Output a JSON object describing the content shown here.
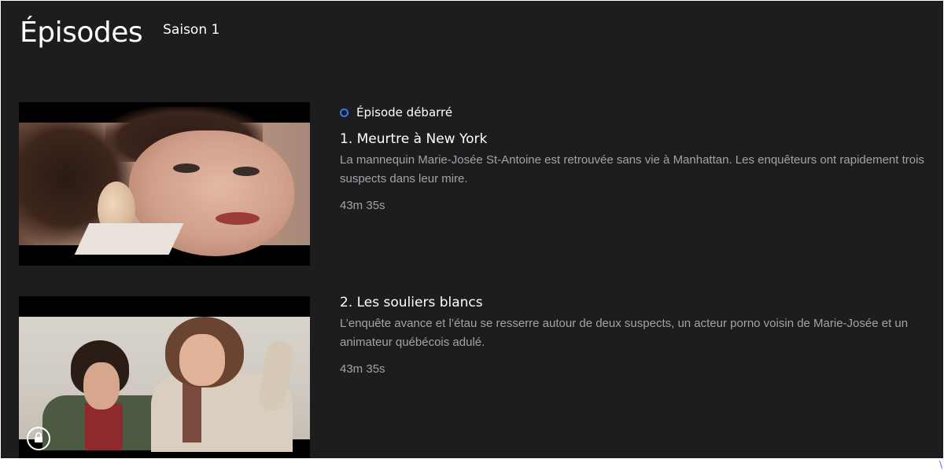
{
  "header": {
    "title": "Épisodes",
    "season_label": "Saison 1"
  },
  "colors": {
    "background": "#1d1c1f",
    "accent": "#2f7df6",
    "text_primary": "#ffffff",
    "text_secondary": "#a3a3a6"
  },
  "episodes": [
    {
      "badge": "Épisode débarré",
      "badge_icon": "radio-dot-icon",
      "title": "1. Meurtre à New York",
      "description": "La mannequin Marie-Josée St-Antoine est retrouvée sans vie à Manhattan. Les enquêteurs ont rapidement trois suspects dans leur mire.",
      "duration": "43m 35s",
      "locked": false
    },
    {
      "title": "2. Les souliers blancs",
      "description": "L’enquête avance et l’étau se resserre autour de deux suspects, un acteur porno voisin de Marie-Josée et un animateur québécois adulé.",
      "duration": "43m 35s",
      "locked": true,
      "lock_icon": "lock-icon"
    }
  ],
  "corner_link": "\\"
}
